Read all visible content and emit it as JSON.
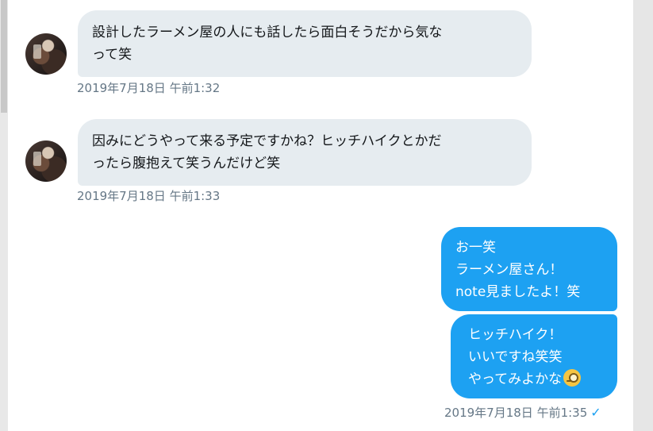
{
  "messages": [
    {
      "direction": "received",
      "text": "設計したラーメン屋の人にも話したら面白そうだから気な\nって笑",
      "timestamp": "2019年7月18日 午前1:32"
    },
    {
      "direction": "received",
      "text": "因みにどうやって来る予定ですかね？ヒッチハイクとかだ\nったら腹抱えて笑うんだけど笑",
      "timestamp": "2019年7月18日 午前1:33"
    },
    {
      "direction": "sent",
      "text": "お一笑\nラーメン屋さん！\nnote見ましたよ！笑"
    },
    {
      "direction": "sent",
      "text": "ヒッチハイク！\nいいですね笑笑\nやってみよかな",
      "emoji": "face-with-monocle-emoji",
      "timestamp": "2019年7月18日 午前1:35",
      "read_icon": "checkmark-icon",
      "read_mark": "✓"
    }
  ],
  "colors": {
    "incoming_bubble": "#e6ecf0",
    "outgoing_bubble": "#1da1f2",
    "timestamp": "#657786",
    "check": "#1da1f2"
  }
}
